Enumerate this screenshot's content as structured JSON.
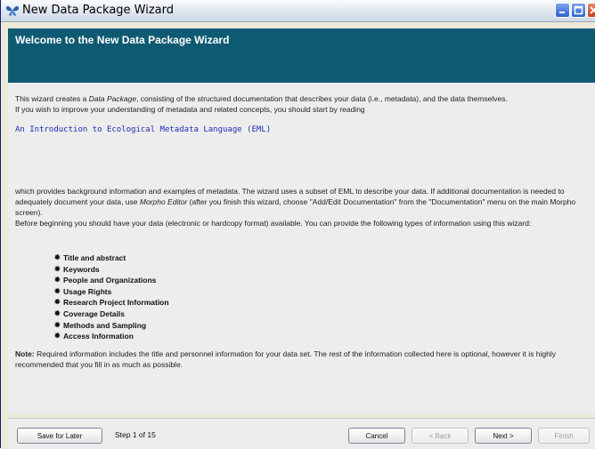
{
  "window": {
    "title": "New Data Package Wizard",
    "app_icon": "butterfly-icon",
    "controls": [
      "minimize-icon",
      "maximize-icon",
      "close-icon"
    ]
  },
  "header": {
    "title": "Welcome to the New Data Package Wizard"
  },
  "content": {
    "intro_line1_pre": "This wizard creates a ",
    "intro_line1_em": "Data Package",
    "intro_line1_post": ", consisting of the structured documentation that describes your data (i.e., metadata), and the data themselves.",
    "intro_line2": "If you wish to improve your understanding of metadata and related concepts, you should start by reading",
    "link_text": "An Introduction to Ecological Metadata Language (EML)",
    "body_pre": "which provides background information and examples of metadata. The wizard uses a subset of EML to describe your data. If additional documentation is needed to adequately document your data, use ",
    "body_em": "Morpho Editor",
    "body_post": " (after you finish this wizard, choose \"Add/Edit Documentation\" from the \"Documentation\" menu on the main Morpho screen).",
    "before_text": "Before beginning you should have your data (electronic or hardcopy format) available. You can provide the following types of information using this wizard:",
    "topics": [
      "Title and abstract",
      "Keywords",
      "People and Organizations",
      "Usage Rights",
      "Research Project Information",
      "Coverage Details",
      "Methods and Sampling",
      "Access Information"
    ],
    "note_label": "Note:",
    "note_text": " Required information includes the title and personnel information for your data set. The rest of the information collected here is optional, however it is highly recommended that you fill in as much as possible."
  },
  "footer": {
    "save_label": "Save for Later",
    "step_label": "Step 1 of 15",
    "cancel_label": "Cancel",
    "back_label": "< Back",
    "next_label": "Next >",
    "finish_label": "Finish"
  },
  "colors": {
    "header_band": "#0f5a73",
    "link": "#1f2bb3",
    "panel": "#ededed"
  }
}
